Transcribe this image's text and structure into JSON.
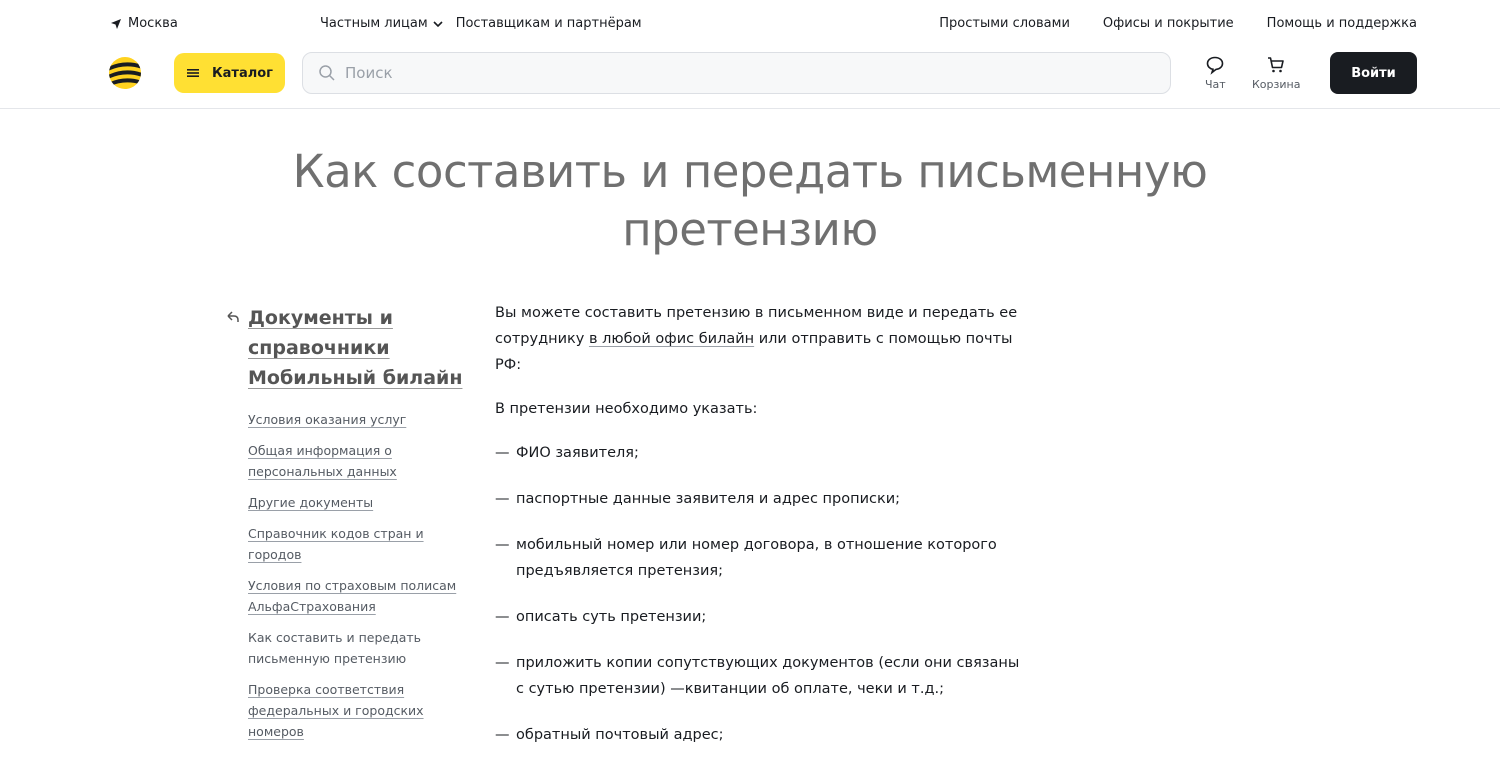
{
  "topbar": {
    "city": "Москва",
    "nav_left": [
      {
        "label": "Частным лицам",
        "dropdown": true
      },
      {
        "label": "Поставщикам и партнёрам",
        "dropdown": false
      }
    ],
    "nav_right": [
      "Простыми словами",
      "Офисы и покрытие",
      "Помощь и поддержка"
    ]
  },
  "header": {
    "catalog_label": "Каталог",
    "search_placeholder": "Поиск",
    "chat_label": "Чат",
    "cart_label": "Корзина",
    "login_label": "Войти",
    "brand_color": "#ffe033"
  },
  "page": {
    "title": "Как составить и передать письменную претензию"
  },
  "sidebar": {
    "section_title": "Документы и справочники Мобильный билайн",
    "items": [
      {
        "label": "Условия оказания услуг",
        "current": false
      },
      {
        "label": "Общая информация о персональных данных",
        "current": false
      },
      {
        "label": "Другие документы",
        "current": false
      },
      {
        "label": "Справочник кодов стран и городов",
        "current": false
      },
      {
        "label": "Условия по страховым полисам АльфаСтрахования",
        "current": false
      },
      {
        "label": "Как составить и передать письменную претензию",
        "current": true
      },
      {
        "label": "Проверка соответствия федеральных и городских номеров",
        "current": false
      }
    ]
  },
  "content": {
    "intro_before": "Вы можете составить претензию в письменном виде и передать ее сотруднику ",
    "intro_link": "в любой офис билайн",
    "intro_after": " или отправить с помощью почты РФ:",
    "must_include": "В претензии необходимо указать:",
    "list": [
      "ФИО заявителя;",
      "паспортные данные заявителя и адрес прописки;",
      "мобильный номер или номер договора, в отношение которого предъявляется претензия;",
      "описать суть претензии;",
      "приложить копии сопутствующих документов (если они связаны с сутью претензии) —квитанции об оплате, чеки и т.д.;",
      "обратный почтовый адрес;"
    ],
    "dash": "—"
  }
}
